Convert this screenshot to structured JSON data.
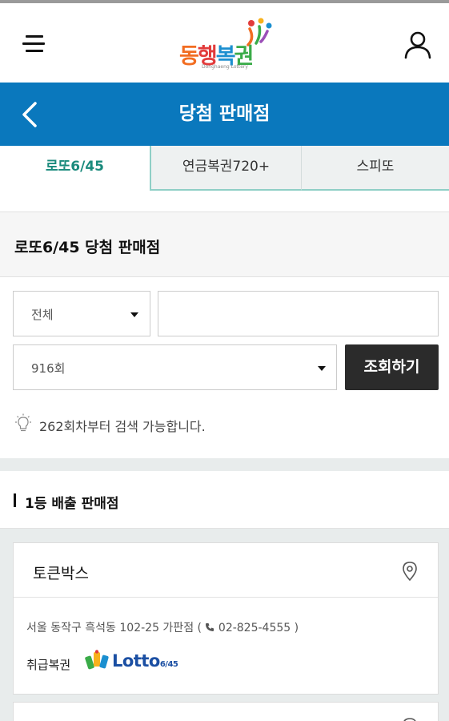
{
  "header": {
    "logo_text_parts": [
      "동",
      "행",
      "복",
      "권"
    ],
    "logo_sub": "Donghaeng Lottery",
    "menu_icon": "hamburger-menu-icon",
    "user_icon": "user-icon"
  },
  "titlebar": {
    "title": "당첨 판매점",
    "back_icon": "chevron-left-icon"
  },
  "tabs": [
    {
      "label": "로또6/45",
      "active": true
    },
    {
      "label": "연금복권720+",
      "active": false
    },
    {
      "label": "스피또",
      "active": false
    }
  ],
  "section": {
    "heading": "로또6/45 당첨 판매점"
  },
  "search": {
    "region_value": "전체",
    "keyword_value": "",
    "round_value": "916회",
    "button_label": "조회하기",
    "hint": "262회차부터 검색 가능합니다."
  },
  "results": {
    "heading": "1등 배출 판매점",
    "stores": [
      {
        "name": "토큰박스",
        "address": "서울 동작구 흑석동 102-25 가판점",
        "phone": "02-825-4555",
        "type_label": "취급복권",
        "lottery_logo": "Lotto",
        "lottery_logo_sub": "6/45"
      }
    ]
  },
  "colors": {
    "brand_blue": "#0a78bd",
    "tab_active": "#1a8a7c",
    "button_dark": "#2b2b2b"
  }
}
